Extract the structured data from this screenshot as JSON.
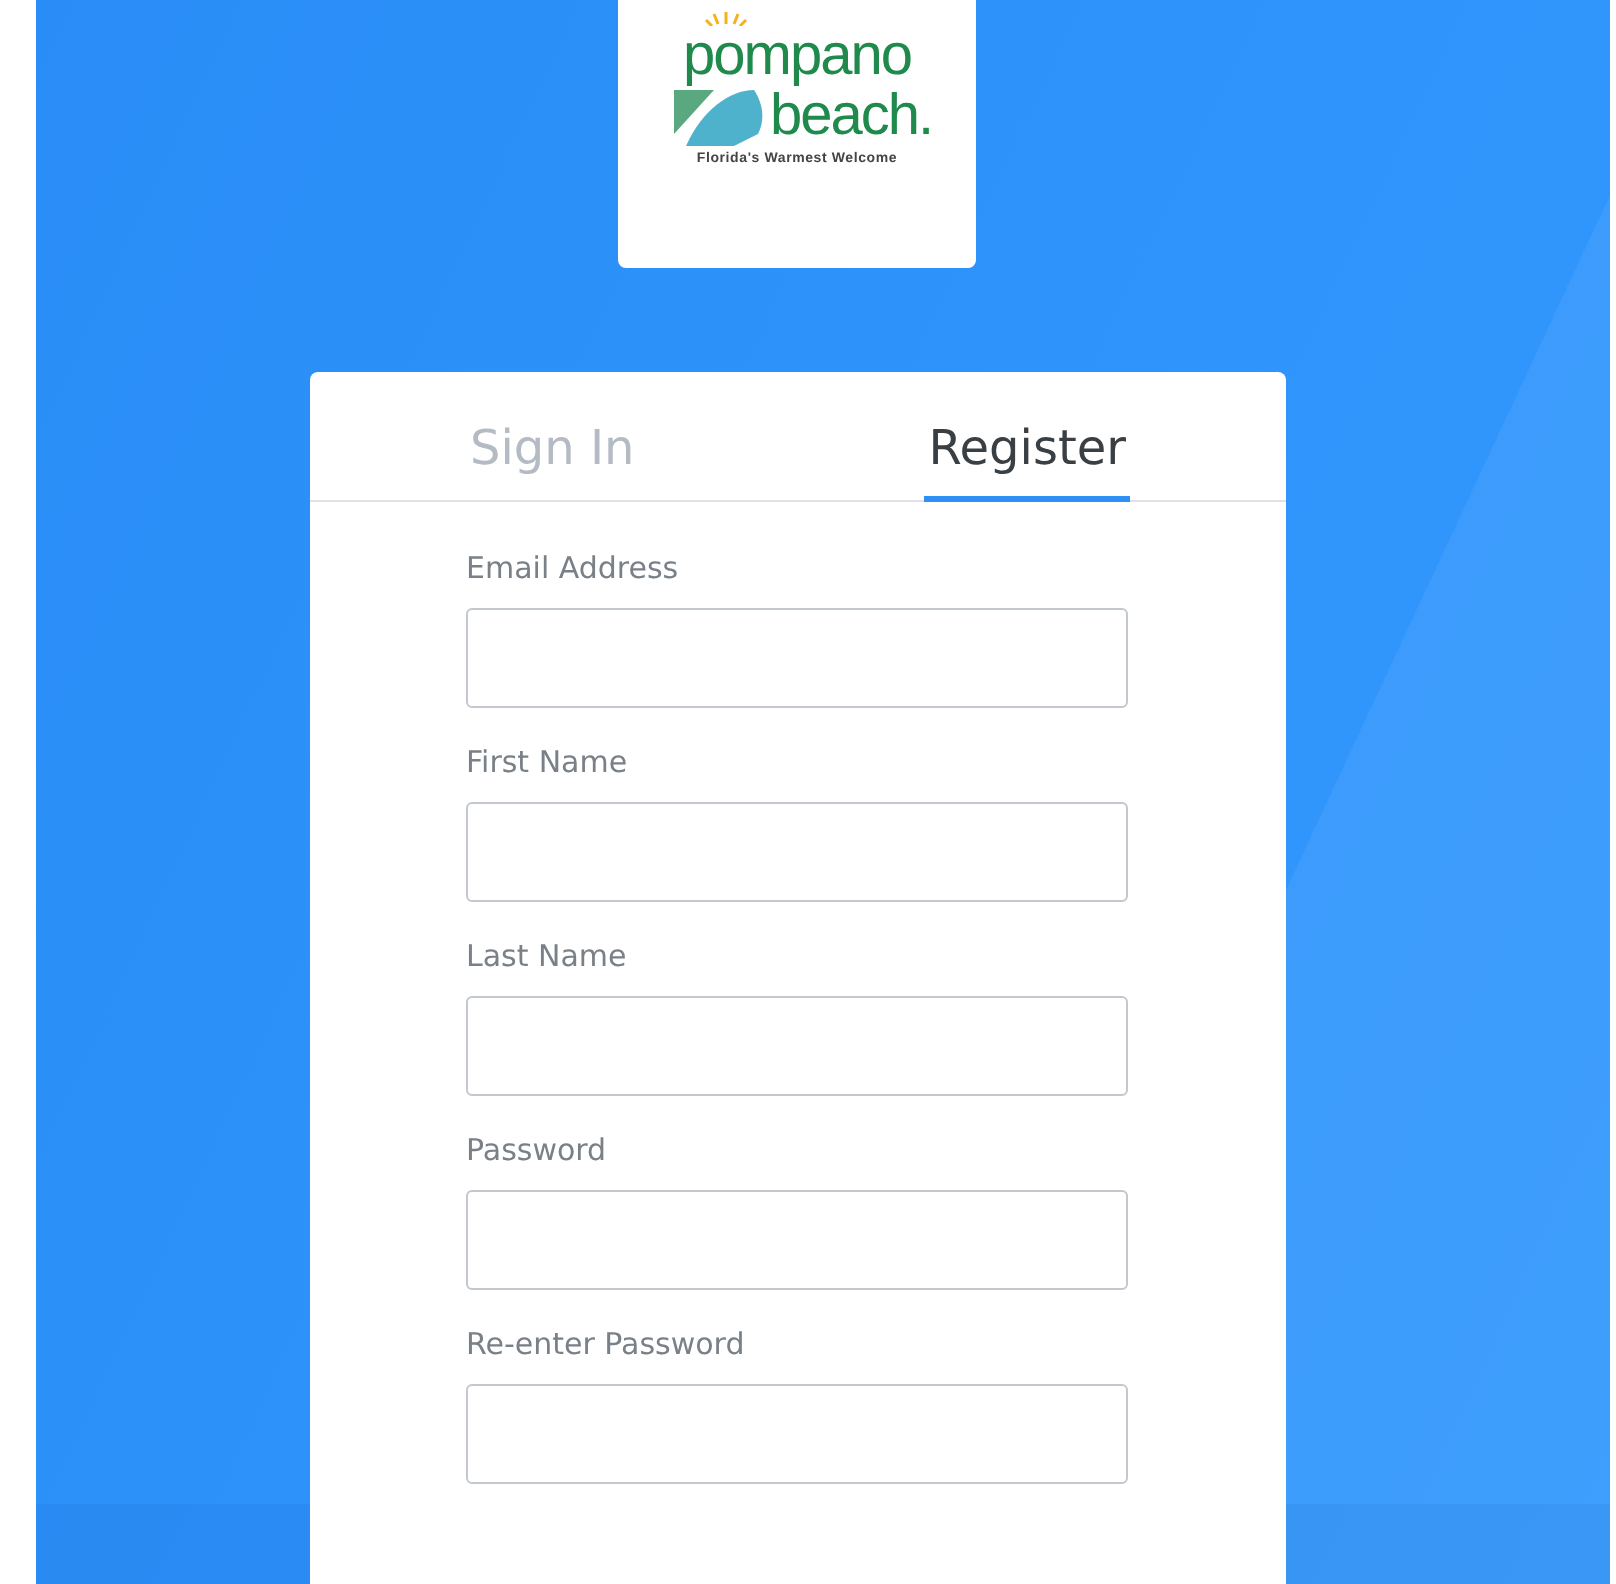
{
  "logo": {
    "name_top": "pompano",
    "name_bottom": "beach.",
    "tagline": "Florida's Warmest Welcome"
  },
  "tabs": [
    {
      "label": "Sign In",
      "selected": false
    },
    {
      "label": "Register",
      "selected": true
    }
  ],
  "fields": [
    {
      "label": "Email Address"
    },
    {
      "label": "First Name"
    },
    {
      "label": "Last Name"
    },
    {
      "label": "Password"
    },
    {
      "label": "Re-enter Password"
    }
  ]
}
